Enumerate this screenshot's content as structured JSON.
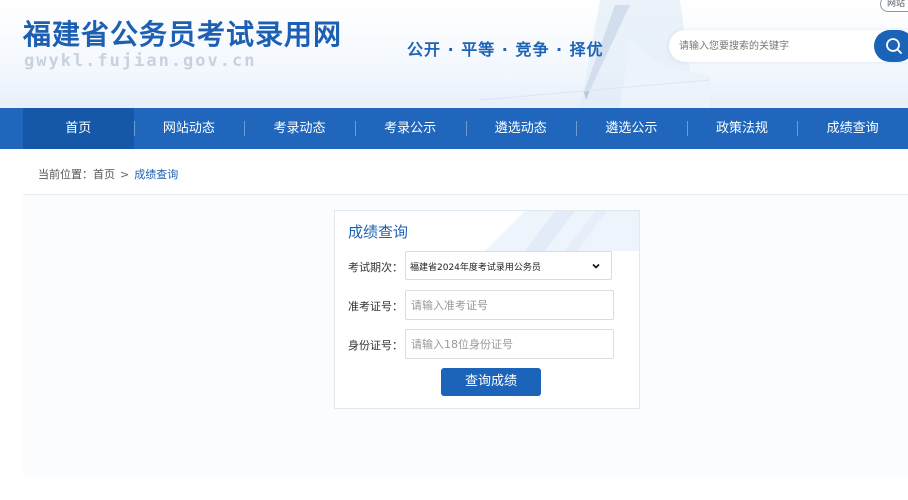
{
  "header": {
    "site_title": "福建省公务员考试录用网",
    "site_domain": "gwykl.fujian.gov.cn",
    "slogan": "公开 · 平等 · 竞争 · 择优",
    "search_placeholder": "请输入您要搜索的关键字",
    "search_icon": "search-icon",
    "top_chip": "网站"
  },
  "nav": {
    "items": [
      {
        "label": "首页",
        "active": true
      },
      {
        "label": "网站动态"
      },
      {
        "label": "考录动态"
      },
      {
        "label": "考录公示"
      },
      {
        "label": "遴选动态"
      },
      {
        "label": "遴选公示"
      },
      {
        "label": "政策法规"
      },
      {
        "label": "成绩查询"
      }
    ]
  },
  "breadcrumb": {
    "prefix": "当前位置：",
    "home": "首页",
    "separator": ">",
    "current": "成绩查询"
  },
  "form": {
    "title": "成绩查询",
    "exam_label": "考试期次：",
    "exam_value": "福建省2024年度考试录用公务员",
    "exam_chevron_icon": "chevron-down-icon",
    "ticket_label": "准考证号：",
    "ticket_placeholder": "请输入准考证号",
    "id_label": "身份证号：",
    "id_placeholder": "请输入18位身份证号",
    "submit_label": "查询成绩"
  },
  "colors": {
    "brand_blue": "#1d5fb3",
    "nav_bg": "#1f66bc",
    "nav_active": "#1558a8",
    "button_bg": "#1c64ba"
  }
}
